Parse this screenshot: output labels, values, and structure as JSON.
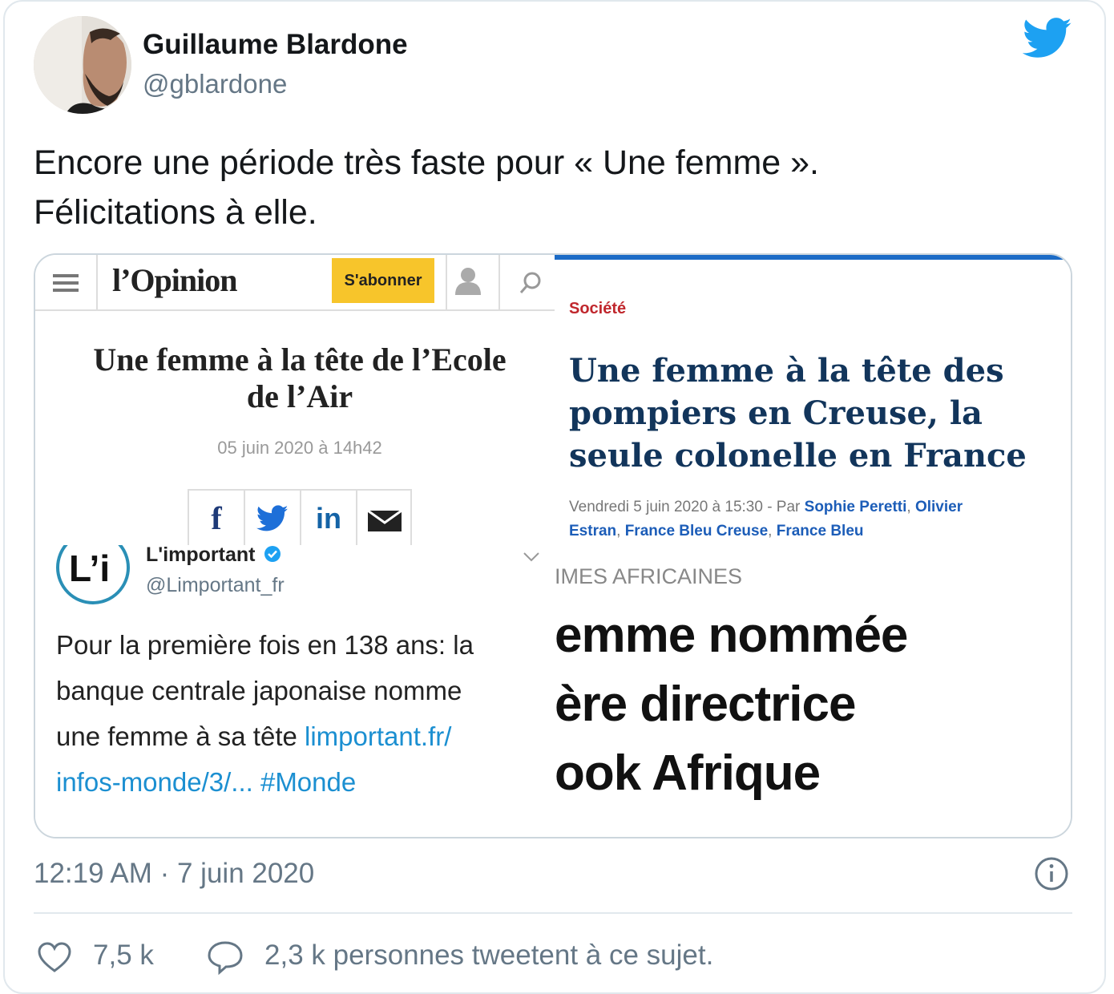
{
  "author": {
    "name": "Guillaume Blardone",
    "handle": "@gblardone"
  },
  "tweet": {
    "line1": "Encore une période très faste pour « Une femme ».",
    "line2": "Félicitations à elle."
  },
  "media": {
    "opinion": {
      "logo": "l’Opinion",
      "subscribe": "S'abonner",
      "headline_line1": "Une femme à la tête de l’Ecole",
      "headline_line2": "de l’Air",
      "date": "05 juin 2020 à 14h42"
    },
    "francebleu": {
      "section": "Société",
      "headline_line1": "Une femme à la tête des",
      "headline_line2": "pompiers en Creuse, la",
      "headline_line3": "seule colonelle en France",
      "byline_prefix": "Vendredi 5 juin 2020 à 15:30 - Par ",
      "author1": "Sophie Peretti",
      "author2_part1": "Olivier",
      "author2_part2": "Estran",
      "source1": "France Bleu Creuse",
      "source2": "France Bleu",
      "comma": ", "
    },
    "limportant": {
      "logo": "L’i",
      "name": "L'important",
      "handle": "@Limportant_fr",
      "text_line1": "Pour la première fois en 138 ans: la",
      "text_line2": "banque centrale japonaise nomme",
      "text_line3": "une femme à sa tête ",
      "link_part1": "limportant.fr/",
      "link_part2": "infos-monde/3/...",
      "hashtag": " #Monde"
    },
    "jeuneafrique": {
      "section": "IMES AFRICAINES",
      "headline_line1": "emme nommée",
      "headline_line2": "ère directrice",
      "headline_line3": "ook Afrique"
    }
  },
  "timestamp": "12:19 AM · 7 juin 2020",
  "likes": "7,5 k",
  "conversation": "2,3 k personnes tweetent à ce sujet.",
  "colors": {
    "twitter_blue": "#1da1f2",
    "francebleu_navy": "#12355b",
    "francebleu_red": "#c0272d",
    "opinion_yellow": "#f7c52b",
    "secondary_text": "#657786"
  }
}
